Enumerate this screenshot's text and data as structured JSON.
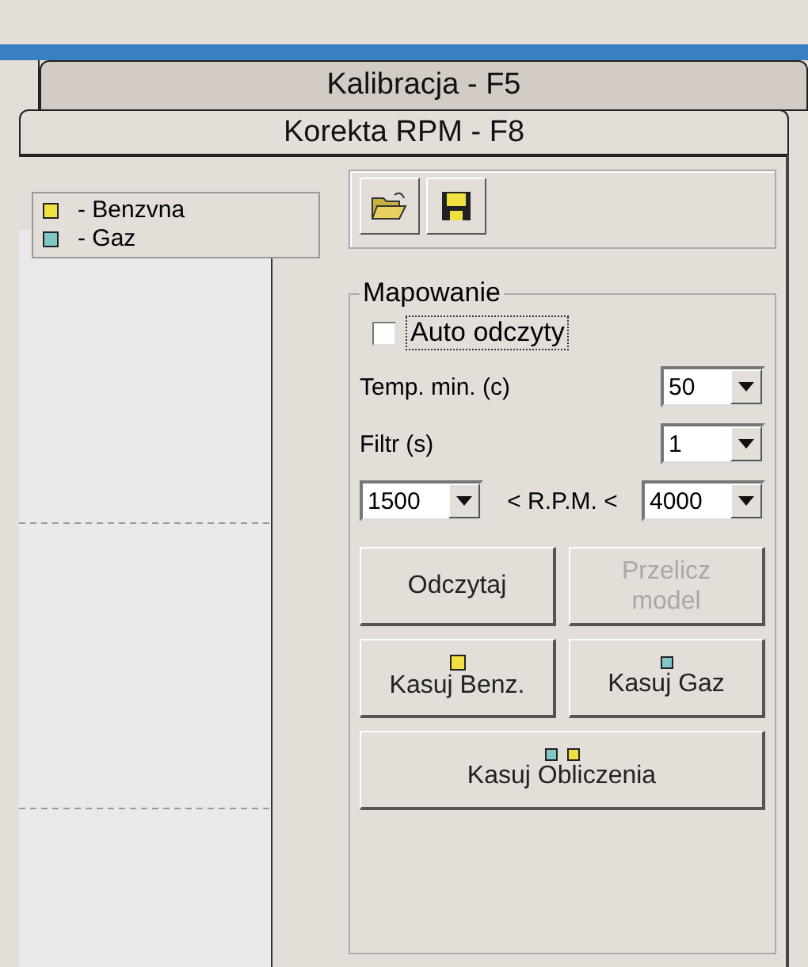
{
  "tabs_back": [
    {
      "label": "Kalibracja - F5",
      "selected": false
    }
  ],
  "tabs_front": [
    {
      "label": "Korekta RPM - F8",
      "selected": true
    }
  ],
  "legend": [
    {
      "label": "- Benzvna",
      "color": "#f0e040"
    },
    {
      "label": "- Gaz",
      "color": "#80c8c8"
    }
  ],
  "toolbar": {
    "buttons": [
      {
        "kind": "open"
      },
      {
        "kind": "save"
      }
    ]
  },
  "mapping": {
    "title": "Mapowanie",
    "auto": {
      "label": "Auto odczyty",
      "checked": false
    },
    "temp": {
      "label": "Temp. min. (c)",
      "value": "50"
    },
    "filter": {
      "label": "Filtr (s)",
      "value": "1"
    },
    "rpm": {
      "min": "1500",
      "label": "< R.P.M. <",
      "max": "4000"
    },
    "buttons": [
      {
        "lines": [
          "Odczytaj"
        ],
        "disabled": false,
        "wide": false
      },
      {
        "lines": [
          "Przelicz",
          "model"
        ],
        "disabled": true,
        "wide": false
      },
      {
        "lines": [
          "Kasuj Benz."
        ],
        "disabled": false,
        "dots": [
          {
            "color": "#f0e040"
          }
        ],
        "wide": false
      },
      {
        "lines": [
          "Kasuj Gaz"
        ],
        "disabled": false,
        "dots": [
          {
            "color": "#80c8c8"
          }
        ],
        "wide": false
      },
      {
        "lines": [
          "Kasuj Obliczenia"
        ],
        "disabled": false,
        "dots": [
          {
            "color": "#80c8c8"
          },
          {
            "color": "#f0e040"
          }
        ],
        "wide": true
      }
    ]
  }
}
